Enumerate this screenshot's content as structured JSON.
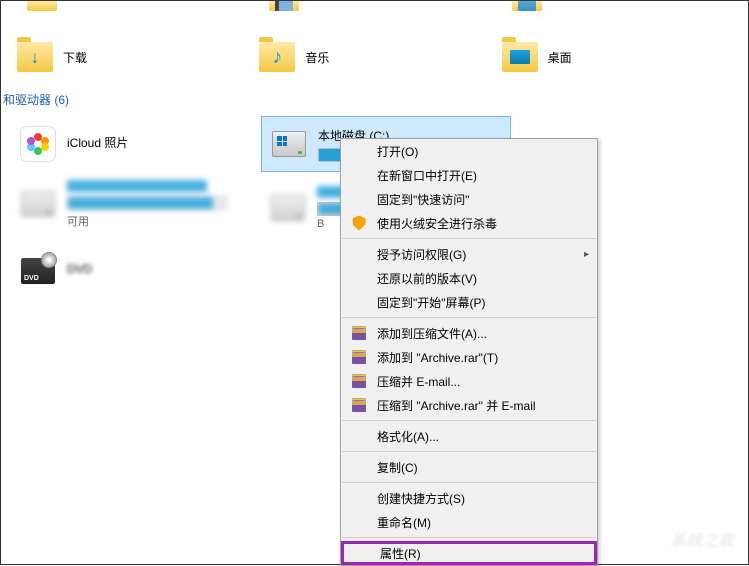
{
  "top_folders_cut": [
    {
      "has_icon": "video"
    },
    {
      "has_icon": "picture"
    }
  ],
  "folders": [
    {
      "name": "下载",
      "icon": "download"
    },
    {
      "name": "音乐",
      "icon": "music"
    },
    {
      "name": "桌面",
      "icon": "desktop"
    }
  ],
  "section": {
    "label": "和驱动器 (6)"
  },
  "drives": [
    {
      "name": "iCloud 照片",
      "icon": "icloud",
      "fill": 0
    },
    {
      "name": "本地磁盘 (C:)",
      "icon": "hdd-win",
      "fill": 58,
      "selected": true
    },
    {
      "name": "",
      "icon": "hdd",
      "fill": 92,
      "blur": true,
      "sub": "可用"
    },
    {
      "name": "",
      "icon": "hdd",
      "fill": 50,
      "blur": true,
      "row": 2,
      "idx": "B"
    },
    {
      "name": "DVD",
      "icon": "dvd",
      "fill": 0,
      "row": 2,
      "no_bar": true,
      "blur_label": true
    }
  ],
  "context_menu": {
    "groups": [
      [
        {
          "label": "打开(O)",
          "bold": false
        },
        {
          "label": "在新窗口中打开(E)"
        },
        {
          "label": "固定到\"快速访问\""
        },
        {
          "label": "使用火绒安全进行杀毒",
          "icon": "shield"
        }
      ],
      [
        {
          "label": "授予访问权限(G)",
          "sub": true
        },
        {
          "label": "还原以前的版本(V)"
        },
        {
          "label": "固定到\"开始\"屏幕(P)"
        }
      ],
      [
        {
          "label": "添加到压缩文件(A)...",
          "icon": "rar"
        },
        {
          "label": "添加到 \"Archive.rar\"(T)",
          "icon": "rar"
        },
        {
          "label": "压缩并 E-mail...",
          "icon": "rar"
        },
        {
          "label": "压缩到 \"Archive.rar\" 并 E-mail",
          "icon": "rar"
        }
      ],
      [
        {
          "label": "格式化(A)..."
        }
      ],
      [
        {
          "label": "复制(C)"
        }
      ],
      [
        {
          "label": "创建快捷方式(S)"
        },
        {
          "label": "重命名(M)"
        }
      ],
      [
        {
          "label": "属性(R)",
          "highlight": true
        }
      ]
    ]
  },
  "watermark": {
    "text": "系统之家"
  }
}
